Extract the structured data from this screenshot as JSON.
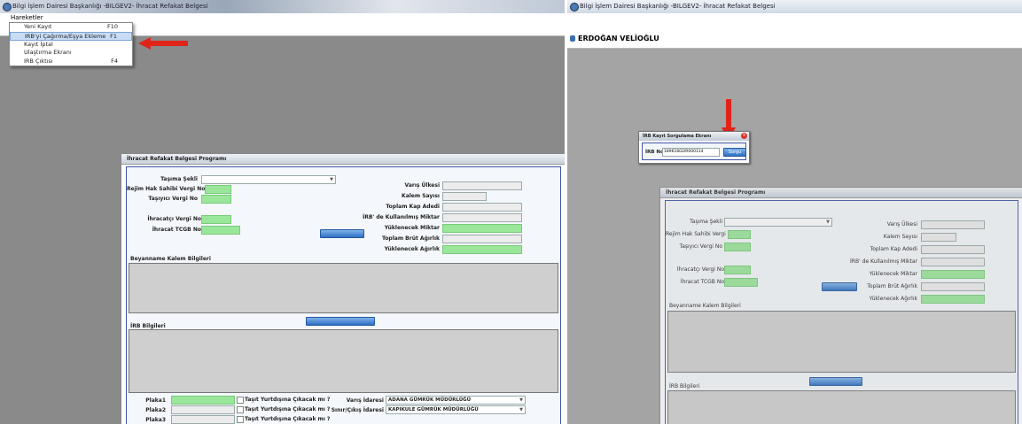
{
  "left": {
    "window_title": "Bilgi İşlem Dairesi Başkanlığı -BILGEV2- İhracat Refakat Belgesi",
    "menu_root": "Hareketler",
    "menu_items": [
      {
        "label": "Yeni Kayıt",
        "shortcut": "F10"
      },
      {
        "label": "IRB'yi Çağırma/Eşya Ekleme",
        "shortcut": "F1"
      },
      {
        "label": "Kayıt İptal",
        "shortcut": ""
      },
      {
        "label": "Ulaştırma Ekranı",
        "shortcut": ""
      },
      {
        "label": "IRB Çıktısı",
        "shortcut": "F4"
      }
    ],
    "form_title": "İhracat Refakat Belgesi Programı",
    "labels": {
      "tasima_sekli": "Taşıma Şekli",
      "rejim": "Rejim Hak Sahibi Vergi No",
      "tasiyici": "Taşıyıcı Vergi No",
      "ihracatci": "İhracatçı Vergi No",
      "tcgb": "İhracat TCGB No",
      "varis_ulkesi": "Varış Ülkesi",
      "kalem_sayisi": "Kalem Sayısı",
      "toplam_kap": "Toplam Kap Adedi",
      "irb_kullanilmis": "İRB' de Kullanılmış Miktar",
      "yuklenecek_miktar": "Yüklenecek Miktar",
      "toplam_brut": "Toplam Brüt Ağırlık",
      "yuklenecek_agirlik": "Yüklenecek Ağırlık",
      "beyanname": "Beyanname Kalem Bilgileri",
      "irb_bilgileri": "İRB Bilgileri",
      "plaka1": "Plaka1",
      "plaka2": "Plaka2",
      "plaka3": "Plaka3",
      "tasit_q": "Taşıt Yurtdışına Çıkacak mı ?",
      "varis_idaresi": "Varış İdaresi",
      "sinir_idaresi": "Sınır/Çıkış İdaresi"
    },
    "varis_idaresi_value": "ADANA GÜMRÜK MÜDÜRLÜĞÜ",
    "sinir_idaresi_value": "KAPIKULE GÜMRÜK MÜDÜRLÜĞÜ"
  },
  "right": {
    "window_title": "Bilgi İşlem Dairesi Başkanlığı -BILGEV2- İhracat Refakat Belgesi",
    "user_name": "ERDOĞAN VELİOĞLU",
    "dialog_title": "İRB Kayıt Sorgulama Ekranı",
    "dialog_label": "İRB No",
    "dialog_value": "18961602IR000114",
    "dialog_button": "Sorgu",
    "form_title": "İhracat Refakat Belgesi Programı",
    "labels": {
      "tasima_sekli": "Taşıma Şekli",
      "rejim": "Rejim Hak Sahibi Vergi No",
      "tasiyici": "Taşıyıcı Vergi No",
      "ihracatci": "İhracatçı Vergi No",
      "tcgb": "İhracat TCGB No",
      "varis_ulkesi": "Varış Ülkesi",
      "kalem_sayisi": "Kalem Sayısı",
      "toplam_kap": "Toplam Kap Adedi",
      "irb_kullanilmis": "İRB' de Kullanılmış Miktar",
      "yuklenecek_miktar": "Yüklenecek Miktar",
      "toplam_brut": "Toplam Brüt Ağırlık",
      "yuklenecek_agirlik": "Yüklenecek Ağırlık",
      "beyanname": "Beyanname Kalem Bilgileri",
      "irb_bilgileri": "İRB Bilgileri"
    }
  },
  "colors": {
    "field_green": "#9ae69a",
    "button_blue": "#2e6fc4",
    "arrow_red": "#e0241a",
    "form_border": "#3e55a6"
  }
}
